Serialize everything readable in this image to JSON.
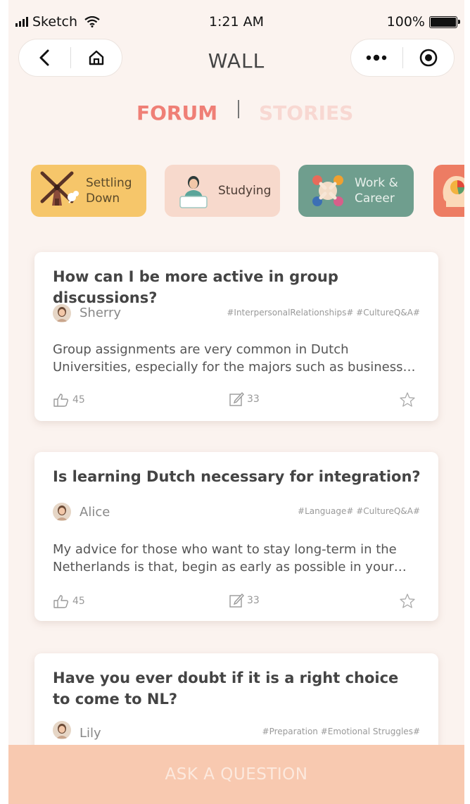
{
  "status_bar": {
    "carrier": "Sketch",
    "time": "1:21 AM",
    "battery": "100%",
    "battery_level": 1.0
  },
  "nav": {
    "title": "WALL"
  },
  "tabs": {
    "forum": "FORUM",
    "stories": "STORIES",
    "active": "forum"
  },
  "categories": [
    {
      "label_line1": "Settling",
      "label_line2": "Down",
      "color": "#f6c66a",
      "icon": "windmill-icon"
    },
    {
      "label_line1": "Studying",
      "label_line2": "",
      "color": "#f7d9cc",
      "icon": "student-icon"
    },
    {
      "label_line1": "Work &",
      "label_line2": "Career",
      "color": "#6f9e8e",
      "icon": "team-icon"
    },
    {
      "label_line1": "",
      "label_line2": "",
      "color": "#ed7c63",
      "icon": "head-icon"
    }
  ],
  "posts": [
    {
      "title": "How can I be more active in group discussions?",
      "author": "Sherry",
      "tags": "#InterpersonalRelationships#  #CultureQ&A#",
      "excerpt_line1": "Group assignments are very common in Dutch",
      "excerpt_line2": "Universities, especially for the majors such as business…",
      "likes": "45",
      "comments": "33"
    },
    {
      "title": "Is learning Dutch necessary for integration?",
      "author": "Alice",
      "tags": "#Language#  #CultureQ&A#",
      "excerpt_line1": "My advice for those who want to stay long-term in the",
      "excerpt_line2": "Netherlands is that, begin as early as possible in your…",
      "likes": "45",
      "comments": "33"
    },
    {
      "title": "Have you ever doubt if it is a right choice to come to NL?",
      "author": "Lily",
      "tags": "#Preparation  #Emotional Struggles#"
    }
  ],
  "footer": {
    "ask_label": "ASK A QUESTION"
  },
  "colors": {
    "accent": "#ef7f76",
    "background": "#fbf3ef",
    "ask_bar": "#f8c9b0"
  }
}
